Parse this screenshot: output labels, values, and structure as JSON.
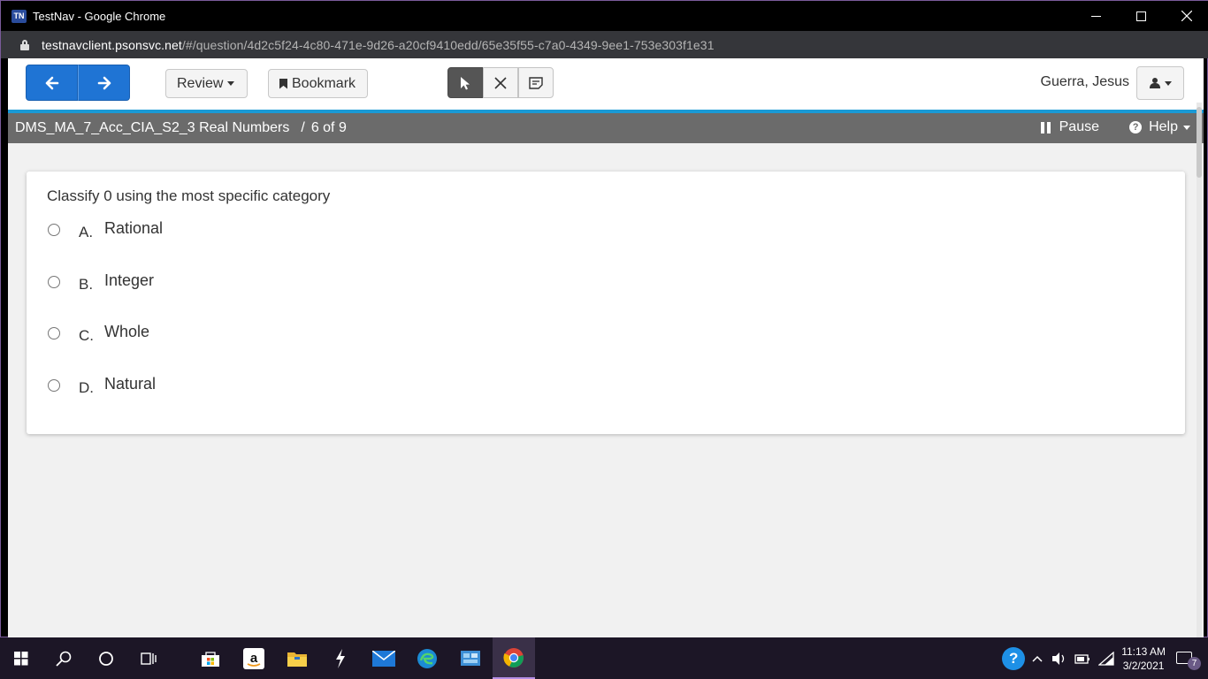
{
  "window": {
    "title": "TestNav - Google Chrome",
    "badge": "TN",
    "url_host": "testnavclient.psonsvc.net",
    "url_path": "/#/question/4d2c5f24-4c80-471e-9d26-a20cf9410edd/65e35f55-c7a0-4349-9ee1-753e303f1e31"
  },
  "toolbar": {
    "review_label": "Review",
    "bookmark_label": "Bookmark",
    "user_name": "Guerra, Jesus"
  },
  "testbar": {
    "test_name": "DMS_MA_7_Acc_CIA_S2_3 Real Numbers",
    "separator": "/",
    "progress": "6 of 9",
    "pause_label": "Pause",
    "help_label": "Help"
  },
  "question": {
    "prompt": "Classify 0 using the most specific category",
    "options": [
      {
        "letter": "A.",
        "text": "Rational"
      },
      {
        "letter": "B.",
        "text": "Integer"
      },
      {
        "letter": "C.",
        "text": "Whole"
      },
      {
        "letter": "D.",
        "text": "Natural"
      }
    ]
  },
  "taskbar": {
    "time": "11:13 AM",
    "date": "3/2/2021",
    "notification_count": "7"
  },
  "colors": {
    "nav_blue": "#1f74d4",
    "accent_rule": "#1a9ad6",
    "testbar_gray": "#6b6b6b"
  }
}
